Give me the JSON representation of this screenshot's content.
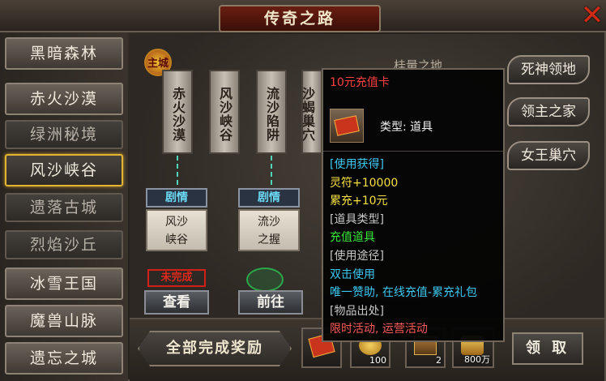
{
  "window": {
    "title": "传奇之路",
    "close_icon": "close-icon"
  },
  "sidebar": {
    "items": [
      {
        "label": "黑暗森林",
        "state": "normal"
      },
      {
        "label": "赤火沙漠",
        "state": "normal"
      },
      {
        "label": "绿洲秘境",
        "state": "dim"
      },
      {
        "label": "风沙峡谷",
        "state": "selected"
      },
      {
        "label": "遗落古城",
        "state": "dim"
      },
      {
        "label": "烈焰沙丘",
        "state": "dim"
      },
      {
        "label": "冰雪王国",
        "state": "normal"
      },
      {
        "label": "魔兽山脉",
        "state": "normal"
      },
      {
        "label": "遗忘之城",
        "state": "normal"
      }
    ]
  },
  "map": {
    "city_badge": "主城",
    "pillars": [
      "赤火沙漠",
      "风沙峡谷",
      "流沙陷阱",
      "沙蝎巢穴"
    ],
    "partial_label": "桂量之地",
    "right_buttons": [
      "死神领地",
      "领主之家",
      "女王巢穴"
    ],
    "story_cards": [
      {
        "tag": "剧情",
        "title": "风沙\n峡谷",
        "status": "未完成",
        "button": "查看"
      },
      {
        "tag": "剧情",
        "title": "流沙\n之握",
        "button": "前往"
      }
    ]
  },
  "bottom": {
    "reward_label": "全部完成奖励",
    "slots": [
      {
        "icon": "recharge-card-icon",
        "count": ""
      },
      {
        "icon": "coin-icon",
        "count": "100"
      },
      {
        "icon": "chest-icon",
        "count": "2"
      },
      {
        "icon": "gold-icon",
        "count": "800万"
      }
    ],
    "claim_label": "领 取"
  },
  "tooltip": {
    "name": "10元充值卡",
    "icon": "recharge-card-icon",
    "type_line": "类型: 道具",
    "rows": [
      {
        "text": "[使用获得]",
        "color": "#3cc8f0"
      },
      {
        "text": "灵符+10000",
        "color": "#f4e040"
      },
      {
        "text": "累充+10元",
        "color": "#f4e040"
      },
      {
        "text": "[道具类型]",
        "color": "#c8c8c8"
      },
      {
        "text": "充值道具",
        "color": "#38e838"
      },
      {
        "text": "[使用途径]",
        "color": "#c8c8c8"
      },
      {
        "text": "双击使用",
        "color": "#3cc8f0"
      },
      {
        "text": "唯一赞助, 在线充值-累充礼包",
        "color": "#3cc8f0"
      },
      {
        "text": "[物品出处]",
        "color": "#c8c8c8"
      },
      {
        "text": "限时活动, 运营活动",
        "color": "#ff5a5a"
      }
    ]
  }
}
